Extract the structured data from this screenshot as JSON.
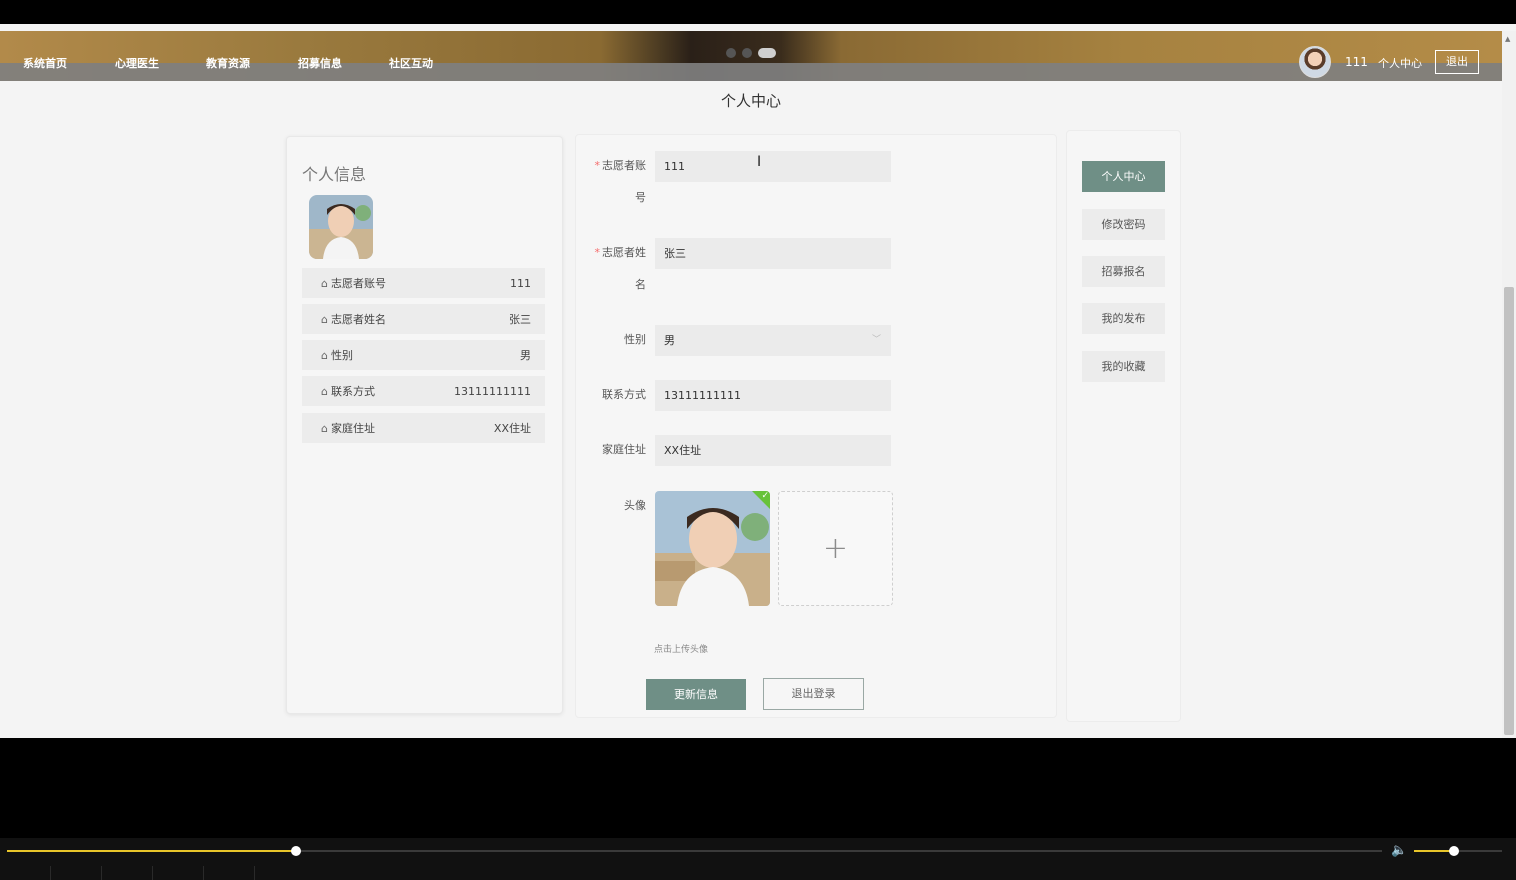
{
  "nav": {
    "items": [
      "系统首页",
      "心理医生",
      "教育资源",
      "招募信息",
      "社区互动"
    ],
    "username": "111",
    "personal_center": "个人中心",
    "logout": "退出"
  },
  "page_title": "个人中心",
  "profile_card": {
    "title": "个人信息",
    "rows": [
      {
        "label": "志愿者账号",
        "value": "111"
      },
      {
        "label": "志愿者姓名",
        "value": "张三"
      },
      {
        "label": "性别",
        "value": "男"
      },
      {
        "label": "联系方式",
        "value": "13111111111"
      },
      {
        "label": "家庭住址",
        "value": "XX住址"
      }
    ]
  },
  "form": {
    "account_label_1": "志愿者账",
    "account_label_2": "号",
    "account_value": "111",
    "name_label_1": "志愿者姓",
    "name_label_2": "名",
    "name_value": "张三",
    "gender_label": "性别",
    "gender_value": "男",
    "phone_label": "联系方式",
    "phone_value": "13111111111",
    "address_label": "家庭住址",
    "address_value": "XX住址",
    "avatar_label": "头像",
    "upload_tip": "点击上传头像",
    "update_button": "更新信息",
    "logout_button": "退出登录"
  },
  "side_menu": {
    "items": [
      "个人中心",
      "修改密码",
      "招募报名",
      "我的发布",
      "我的收藏"
    ],
    "active_index": 0
  },
  "colors": {
    "accent": "#6f8f86",
    "required": "#f56c6c",
    "progress": "#e8c52a"
  },
  "player": {
    "progress_fraction": 0.21,
    "volume_fraction": 0.45
  }
}
